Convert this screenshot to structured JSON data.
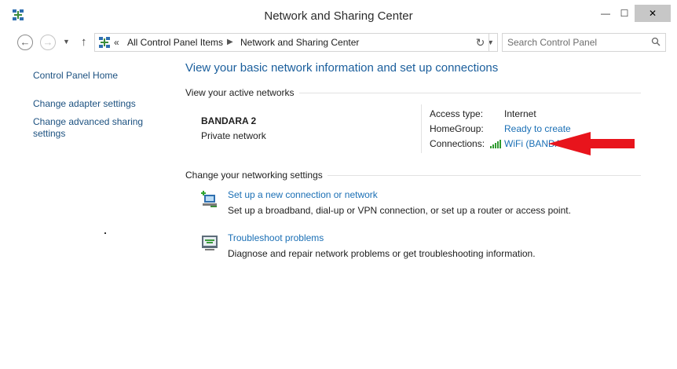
{
  "window": {
    "title": "Network and Sharing Center",
    "minimize_glyph": "—",
    "maximize_glyph": "☐",
    "close_glyph": "✕"
  },
  "nav": {
    "back_glyph": "←",
    "forward_glyph": "→",
    "up_glyph": "↑",
    "chevrons": "«",
    "breadcrumb": [
      "All Control Panel Items",
      "Network and Sharing Center"
    ],
    "refresh_glyph": "↻",
    "search_placeholder": "Search Control Panel"
  },
  "sidebar": {
    "items": [
      {
        "label": "Control Panel Home"
      },
      {
        "label": "Change adapter settings"
      },
      {
        "label": "Change advanced sharing settings"
      }
    ]
  },
  "main": {
    "heading": "View your basic network information and set up connections",
    "active_networks_label": "View your active networks",
    "network": {
      "name": "BANDARA  2",
      "type": "Private network",
      "access_type_key": "Access type:",
      "access_type_value": "Internet",
      "homegroup_key": "HomeGroup:",
      "homegroup_value": "Ready to create",
      "connections_key": "Connections:",
      "connections_value": "WiFi (BANDARA  2)"
    },
    "change_settings_label": "Change your networking settings",
    "tasks": [
      {
        "icon": "new-connection-icon",
        "title": "Set up a new connection or network",
        "description": "Set up a broadband, dial-up or VPN connection, or set up a router or access point."
      },
      {
        "icon": "troubleshoot-icon",
        "title": "Troubleshoot problems",
        "description": "Diagnose and repair network problems or get troubleshooting information."
      }
    ]
  },
  "annotation": {
    "arrow_color": "#e8141c"
  },
  "colors": {
    "link": "#1a6fb5",
    "heading": "#1a5e9c",
    "sidebar_link": "#1c5180",
    "close_button": "#c7c7c7"
  }
}
